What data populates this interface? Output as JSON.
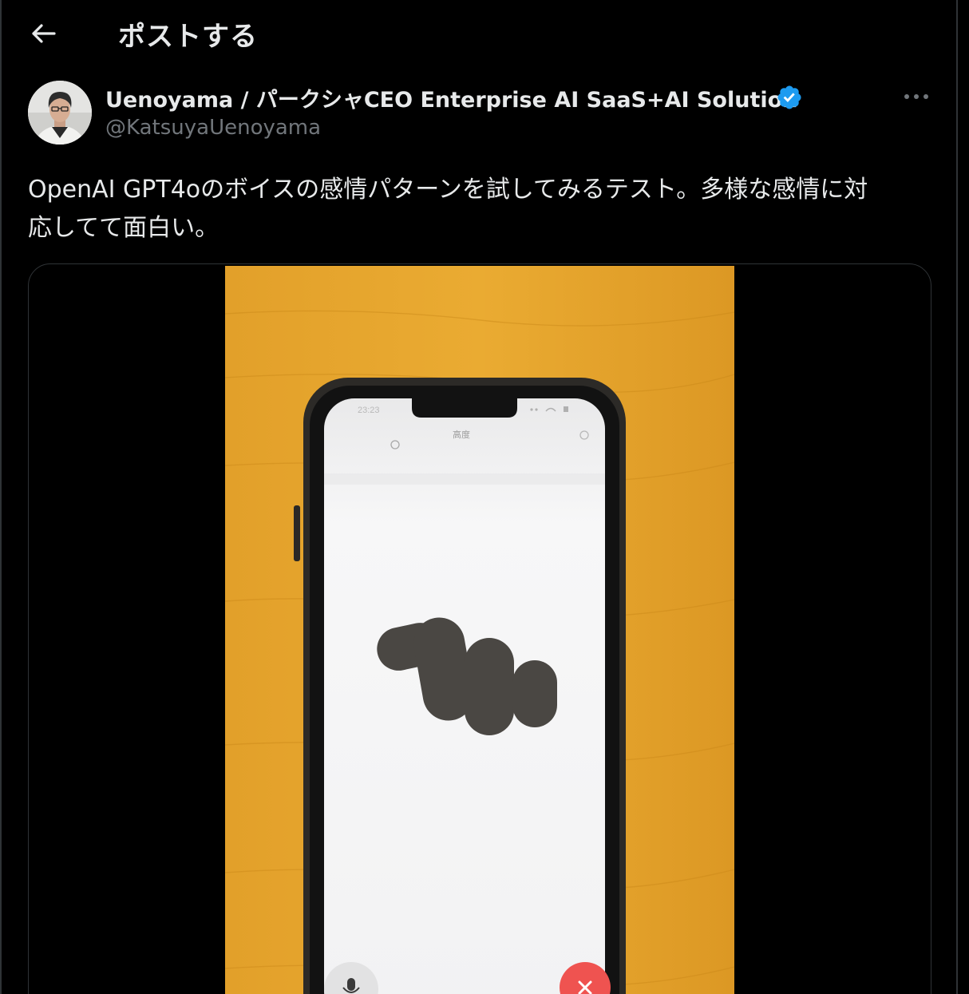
{
  "header": {
    "back_icon": "back-arrow-icon",
    "title": "ポストする"
  },
  "post": {
    "author_name": "Uenoyama / パークシャCEO Enterprise AI SaaS+AI Solution",
    "handle": "@KatsuyaUenoyama",
    "verified_icon": "verified-badge-icon",
    "more_icon": "more-options-icon",
    "text_line1": "OpenAI GPT4oのボイスの感情パターンを試してみるテスト。多様な感情に対",
    "text_line2": "応してて面白い。"
  },
  "video": {
    "phone_time": "23:23",
    "app_title": "高度",
    "mic_icon": "microphone-icon",
    "close_icon": "close-icon"
  },
  "colors": {
    "background": "#000000",
    "text": "#e7e9ea",
    "secondary_text": "#71767b",
    "verified": "#1d9bf0",
    "border": "#2f3336",
    "video_bg": "#dd9a22",
    "end_call": "#ef5350"
  }
}
